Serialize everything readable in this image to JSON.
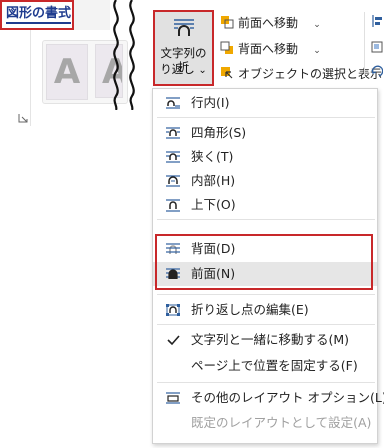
{
  "ribbon": {
    "tab_title": "図形の書式",
    "wrap_text_button": {
      "line1": "文字列の折",
      "line2": "り返し",
      "chevron": "⌄"
    },
    "styles_gallery": {
      "sample1": "A",
      "sample2": "A"
    },
    "bring_forward": {
      "label": "前面へ移動",
      "chevron": "⌄"
    },
    "send_backward": {
      "label": "背面へ移動",
      "chevron": "⌄"
    },
    "selection_pane": {
      "label": "オブジェクトの選択と表示"
    }
  },
  "wrap_menu": {
    "items": [
      {
        "label": "行内(I)",
        "icon": "inline-icon"
      },
      {
        "label": "四角形(S)",
        "icon": "square-wrap-icon"
      },
      {
        "label": "狭く(T)",
        "icon": "tight-wrap-icon"
      },
      {
        "label": "内部(H)",
        "icon": "through-wrap-icon"
      },
      {
        "label": "上下(O)",
        "icon": "top-bottom-wrap-icon"
      },
      {
        "label": "背面(D)",
        "icon": "behind-text-icon"
      },
      {
        "label": "前面(N)",
        "icon": "in-front-text-icon"
      },
      {
        "label": "折り返し点の編集(E)",
        "icon": "edit-wrap-points-icon"
      },
      {
        "label": "文字列と一緒に移動する(M)",
        "icon": "checkmark-icon",
        "checked": true
      },
      {
        "label": "ページ上で位置を固定する(F)",
        "icon": ""
      },
      {
        "label": "その他のレイアウト オプション(L)...",
        "icon": "layout-options-icon"
      },
      {
        "label": "既定のレイアウトとして設定(A)",
        "icon": "",
        "disabled": true
      }
    ]
  },
  "colors": {
    "highlight_border": "#c8282a",
    "icon_blue": "#2f5f9e",
    "hover_gray": "#e6e6e6",
    "tab_text": "#1f3c8f"
  }
}
